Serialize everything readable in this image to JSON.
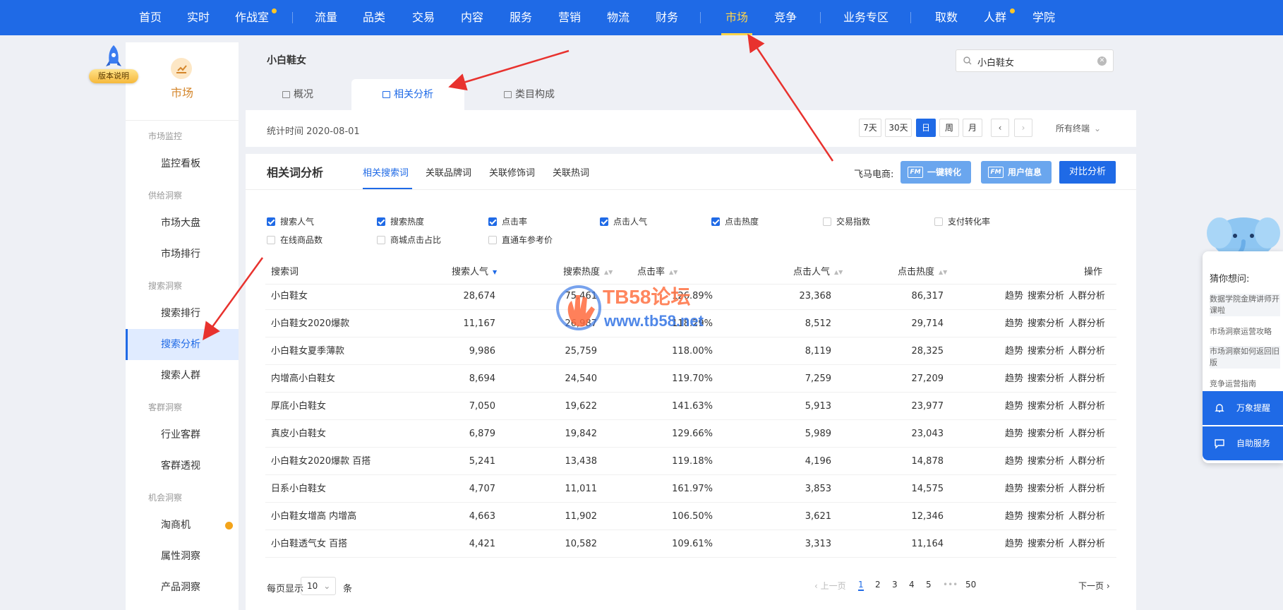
{
  "topnav": {
    "items": [
      "首页",
      "实时",
      "作战室",
      "流量",
      "品类",
      "交易",
      "内容",
      "服务",
      "营销",
      "物流",
      "财务",
      "市场",
      "竞争",
      "业务专区",
      "取数",
      "人群",
      "学院"
    ],
    "active": "市场"
  },
  "sidebar": {
    "badge": "版本说明",
    "brand": "市场",
    "groups": {
      "g1": "市场监控",
      "g2": "供给洞察",
      "g3": "搜索洞察",
      "g4": "客群洞察",
      "g5": "机会洞察"
    },
    "items": {
      "i1": "监控看板",
      "i2": "市场大盘",
      "i3": "市场排行",
      "i4": "搜索排行",
      "i5": "搜索分析",
      "i6": "搜索人群",
      "i7": "行业客群",
      "i8": "客群透视",
      "i9": "淘商机",
      "i10": "属性洞察",
      "i11": "产品洞察"
    }
  },
  "header": {
    "keyword": "小白鞋女",
    "search_value": "小白鞋女",
    "tabs": [
      "概况",
      "相关分析",
      "类目构成"
    ],
    "stat_time": "统计时间 2020-08-01",
    "periods": [
      "7天",
      "30天",
      "日",
      "周",
      "月"
    ],
    "terminal": "所有终端"
  },
  "analysis": {
    "title": "相关词分析",
    "subtabs": [
      "相关搜索词",
      "关联品牌词",
      "关联修饰词",
      "关联热词"
    ],
    "fm_label": "飞马电商:",
    "fm_btn1": "一键转化",
    "fm_btn2": "用户信息",
    "fm_logo": "FM",
    "compare": "对比分析"
  },
  "filters": [
    {
      "label": "搜索人气",
      "checked": true
    },
    {
      "label": "搜索热度",
      "checked": true
    },
    {
      "label": "点击率",
      "checked": true
    },
    {
      "label": "点击人气",
      "checked": true
    },
    {
      "label": "点击热度",
      "checked": true
    },
    {
      "label": "交易指数",
      "checked": false
    },
    {
      "label": "支付转化率",
      "checked": false
    },
    {
      "label": "在线商品数",
      "checked": false
    },
    {
      "label": "商城点击占比",
      "checked": false
    },
    {
      "label": "直通车参考价",
      "checked": false
    }
  ],
  "table": {
    "headers": [
      "搜索词",
      "搜索人气",
      "搜索热度",
      "点击率",
      "点击人气",
      "点击热度",
      "操作"
    ],
    "ops": [
      "趋势",
      "搜索分析",
      "人群分析"
    ],
    "rows": [
      [
        "小白鞋女",
        "28,674",
        "75,461",
        "126.89%",
        "23,368",
        "86,317"
      ],
      [
        "小白鞋女2020爆款",
        "11,167",
        "26,987",
        "118.29%",
        "8,512",
        "29,714"
      ],
      [
        "小白鞋女夏季薄款",
        "9,986",
        "25,759",
        "118.00%",
        "8,119",
        "28,325"
      ],
      [
        "内增高小白鞋女",
        "8,694",
        "24,540",
        "119.70%",
        "7,259",
        "27,209"
      ],
      [
        "厚底小白鞋女",
        "7,050",
        "19,622",
        "141.63%",
        "5,913",
        "23,977"
      ],
      [
        "真皮小白鞋女",
        "6,879",
        "19,842",
        "129.66%",
        "5,989",
        "23,043"
      ],
      [
        "小白鞋女2020爆款 百搭",
        "5,241",
        "13,438",
        "119.18%",
        "4,196",
        "14,878"
      ],
      [
        "日系小白鞋女",
        "4,707",
        "11,011",
        "161.97%",
        "3,853",
        "14,575"
      ],
      [
        "小白鞋女增高 内增高",
        "4,663",
        "11,902",
        "106.50%",
        "3,621",
        "12,346"
      ],
      [
        "小白鞋透气女 百搭",
        "4,421",
        "10,582",
        "109.61%",
        "3,313",
        "11,164"
      ]
    ]
  },
  "pager": {
    "per_page": "每页显示",
    "size": "10",
    "unit": "条",
    "prev": "上一页",
    "pages": [
      "1",
      "2",
      "3",
      "4",
      "5",
      "•••",
      "50"
    ],
    "next": "下一页"
  },
  "float_panel": {
    "title": "猜你想问:",
    "links": [
      "数据学院金牌讲师开课啦",
      "市场洞察运营攻略",
      "市场洞察如何返回旧版",
      "竞争运营指南"
    ],
    "btn1": "万象提醒",
    "btn2": "自助服务"
  },
  "watermark": {
    "title": "TB58论坛",
    "url": "www.tb58.net"
  },
  "colors": {
    "primary": "#1f6ae6",
    "nav_active": "#ffd54a",
    "brand_orange": "#d4862b",
    "annotation_red": "#e8322e"
  }
}
